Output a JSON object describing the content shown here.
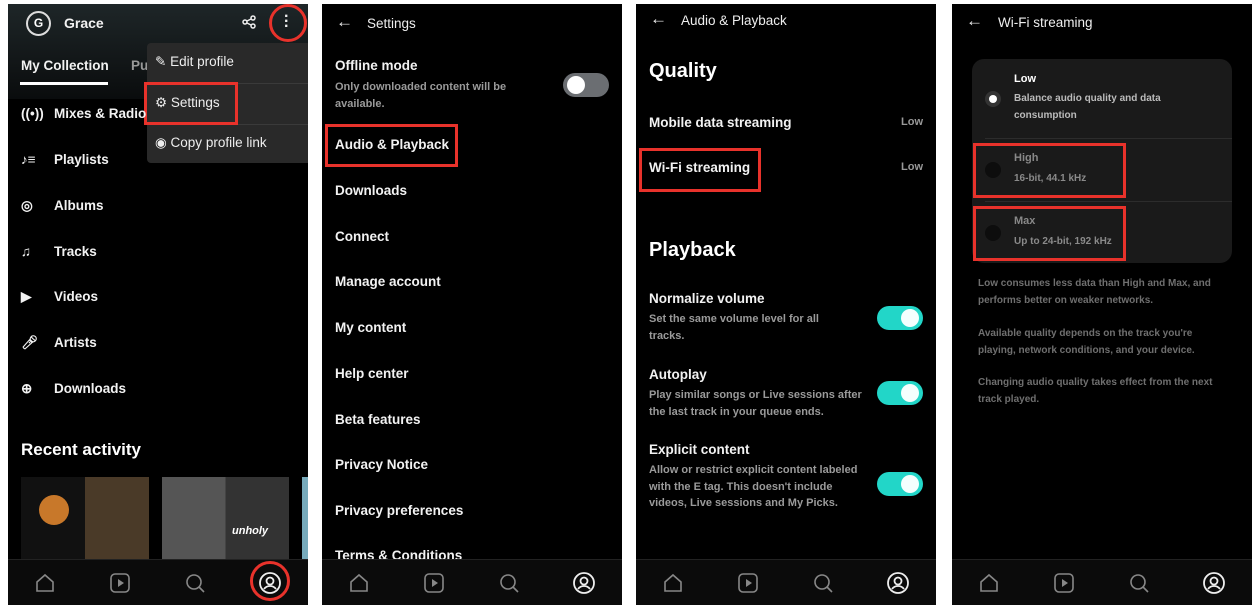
{
  "panel1": {
    "avatar_initial": "G",
    "user_name": "Grace",
    "tabs": [
      "My Collection",
      "Pu"
    ],
    "menu": [
      "Edit profile",
      "Settings",
      "Copy profile link"
    ],
    "nav_items": [
      "Mixes & Radio",
      "Playlists",
      "Albums",
      "Tracks",
      "Videos",
      "Artists",
      "Downloads"
    ],
    "recent_title": "Recent activity",
    "album_text": [
      "unholy"
    ]
  },
  "panel2": {
    "title": "Settings",
    "offline_title": "Offline mode",
    "offline_desc": "Only downloaded content will be available.",
    "offline_enabled": false,
    "items": [
      "Audio & Playback",
      "Downloads",
      "Connect",
      "Manage account",
      "My content",
      "Help center",
      "Beta features",
      "Privacy Notice",
      "Privacy preferences",
      "Terms & Conditions"
    ]
  },
  "panel3": {
    "title": "Audio & Playback",
    "quality_heading": "Quality",
    "mobile_label": "Mobile data streaming",
    "mobile_value": "Low",
    "wifi_label": "Wi-Fi streaming",
    "wifi_value": "Low",
    "playback_heading": "Playback",
    "normalize_title": "Normalize volume",
    "normalize_desc": "Set the same volume level for all tracks.",
    "autoplay_title": "Autoplay",
    "autoplay_desc": "Play similar songs or Live sessions after the last track in your queue ends.",
    "explicit_title": "Explicit content",
    "explicit_desc": "Allow or restrict explicit content labeled with the E tag. This doesn't include videos, Live sessions and My Picks.",
    "toggles_on": true,
    "accent": "#22d6c8"
  },
  "panel4": {
    "title": "Wi-Fi streaming",
    "options": [
      {
        "label": "Low",
        "desc": "Balance audio quality and data consumption",
        "selected": true
      },
      {
        "label": "High",
        "desc": "16-bit, 44.1 kHz",
        "selected": false
      },
      {
        "label": "Max",
        "desc": "Up to 24-bit, 192 kHz",
        "selected": false
      }
    ],
    "notes": [
      "Low consumes less data than High and Max, and performs better on weaker networks.",
      "Available quality depends on the track you're playing, network conditions, and your device.",
      "Changing audio quality takes effect from the next track played."
    ]
  },
  "highlight_color": "#e8322b"
}
